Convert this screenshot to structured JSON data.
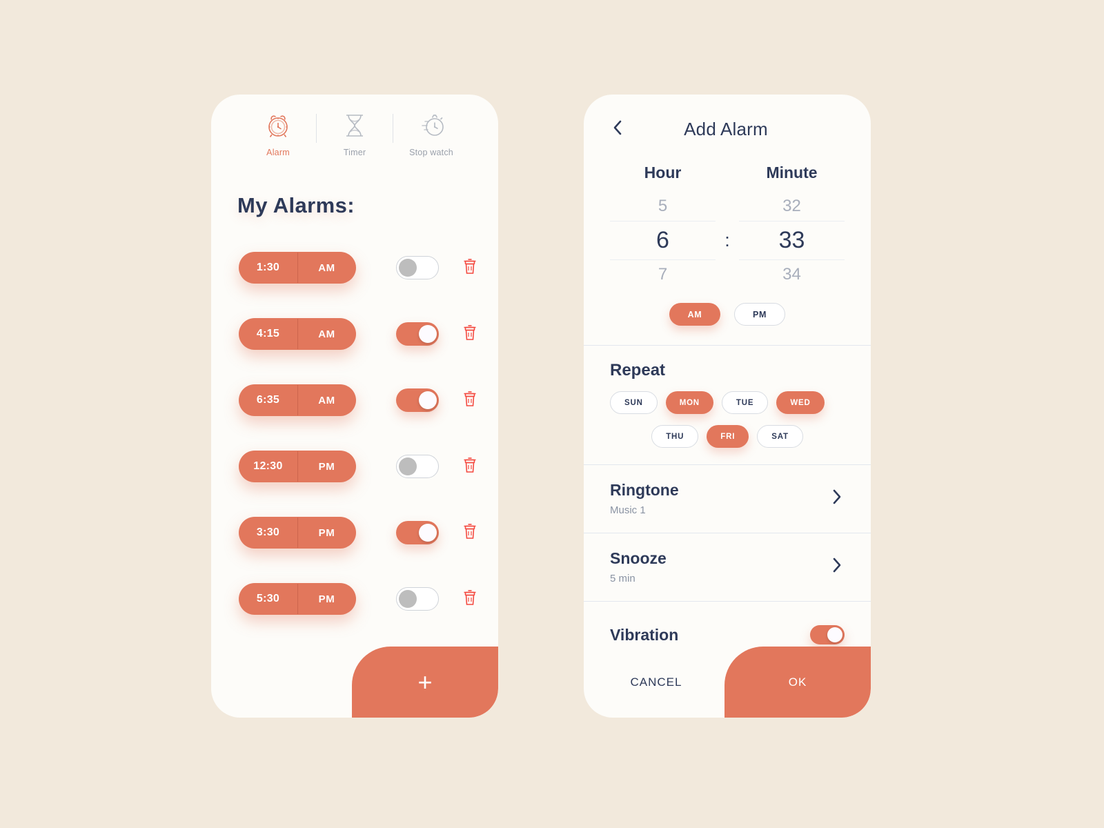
{
  "theme": {
    "background": "#f2e9dc",
    "card": "#fdfcf9",
    "accent": "#e2775c",
    "navy": "#2e3a59",
    "muted": "#9aa0ab",
    "danger": "#f4483f"
  },
  "alarm_screen": {
    "tabs": [
      {
        "label": "Alarm",
        "icon": "alarm-clock-icon",
        "active": true
      },
      {
        "label": "Timer",
        "icon": "hourglass-icon",
        "active": false
      },
      {
        "label": "Stop watch",
        "icon": "stopwatch-icon",
        "active": false
      }
    ],
    "heading": "My Alarms:",
    "alarms": [
      {
        "time": "1:30",
        "meridiem": "AM",
        "enabled": false
      },
      {
        "time": "4:15",
        "meridiem": "AM",
        "enabled": true
      },
      {
        "time": "6:35",
        "meridiem": "AM",
        "enabled": true
      },
      {
        "time": "12:30",
        "meridiem": "PM",
        "enabled": false
      },
      {
        "time": "3:30",
        "meridiem": "PM",
        "enabled": true
      },
      {
        "time": "5:30",
        "meridiem": "PM",
        "enabled": false
      }
    ],
    "delete_icon": "trash-icon",
    "add_button_label": "+"
  },
  "add_alarm_screen": {
    "back_icon": "chevron-left-icon",
    "title": "Add Alarm",
    "picker": {
      "hour_label": "Hour",
      "minute_label": "Minute",
      "separator": ":",
      "hour_prev": "5",
      "hour_selected": "6",
      "hour_next": "7",
      "minute_prev": "32",
      "minute_selected": "33",
      "minute_next": "34",
      "am_label": "AM",
      "pm_label": "PM",
      "meridiem_selected": "AM"
    },
    "repeat": {
      "title": "Repeat",
      "days": [
        {
          "label": "SUN",
          "selected": false
        },
        {
          "label": "MON",
          "selected": true
        },
        {
          "label": "TUE",
          "selected": false
        },
        {
          "label": "WED",
          "selected": true
        },
        {
          "label": "THU",
          "selected": false
        },
        {
          "label": "FRI",
          "selected": true
        },
        {
          "label": "SAT",
          "selected": false
        }
      ]
    },
    "ringtone": {
      "label": "Ringtone",
      "value": "Music 1",
      "chevron": "chevron-right-icon"
    },
    "snooze": {
      "label": "Snooze",
      "value": "5 min",
      "chevron": "chevron-right-icon"
    },
    "vibration": {
      "label": "Vibration",
      "enabled": true
    },
    "cancel_label": "CANCEL",
    "ok_label": "OK"
  }
}
